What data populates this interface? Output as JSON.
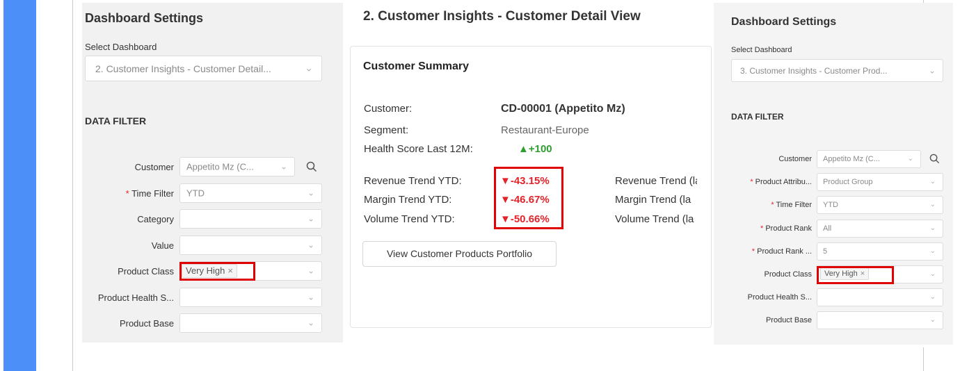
{
  "left_panel": {
    "title": "Dashboard Settings",
    "select_label": "Select Dashboard",
    "select_value": "2. Customer Insights - Customer Detail...",
    "section": "DATA FILTER",
    "filters": [
      {
        "label": "Customer",
        "value": "Appetito Mz (C...",
        "required": false
      },
      {
        "label": "Time Filter",
        "value": "YTD",
        "required": true
      },
      {
        "label": "Category",
        "value": "",
        "required": false
      },
      {
        "label": "Value",
        "value": "",
        "required": false
      },
      {
        "label": "Product Class",
        "value": "",
        "tag": "Very High",
        "required": false
      },
      {
        "label": "Product Health S...",
        "value": "",
        "required": false
      },
      {
        "label": "Product Base",
        "value": "",
        "required": false
      }
    ]
  },
  "middle": {
    "title": "2. Customer Insights - Customer Detail View",
    "card_title": "Customer Summary",
    "info": [
      {
        "label": "Customer:",
        "value": "CD-00001 (Appetito Mz)"
      },
      {
        "label": "Segment:",
        "value": "Restaurant-Europe"
      },
      {
        "label": "Health Score Last 12M:",
        "value": "▲+100"
      }
    ],
    "trends": [
      {
        "label": "Revenue Trend YTD:",
        "value": "▼-43.15%",
        "ghost": "Revenue Trend (la"
      },
      {
        "label": "Margin Trend YTD:",
        "value": "▼-46.67%",
        "ghost": "Margin Trend (la"
      },
      {
        "label": "Volume Trend YTD:",
        "value": "▼-50.66%",
        "ghost": "Volume Trend (la"
      }
    ],
    "button": "View Customer Products Portfolio"
  },
  "right_panel": {
    "title": "Dashboard Settings",
    "select_label": "Select Dashboard",
    "select_value": "3. Customer Insights - Customer Prod...",
    "section": "DATA FILTER",
    "filters": [
      {
        "label": "Customer",
        "value": "Appetito Mz (C...",
        "required": false
      },
      {
        "label": "Product Attribu...",
        "value": "Product Group",
        "required": true
      },
      {
        "label": "Time Filter",
        "value": "YTD",
        "required": true
      },
      {
        "label": "Product Rank",
        "value": "All",
        "required": true
      },
      {
        "label": "Product Rank ...",
        "value": "5",
        "required": true
      },
      {
        "label": "Product Class",
        "value": "",
        "tag": "Very High",
        "required": false
      },
      {
        "label": "Product Health S...",
        "value": "",
        "required": false
      },
      {
        "label": "Product Base",
        "value": "",
        "required": false
      }
    ]
  },
  "glyphs": {
    "chevron": "⌄",
    "tag_close": "×",
    "req": "*"
  },
  "colors": {
    "accent_blue": "#4d8ff8",
    "trend_red": "#e2232a",
    "health_green": "#2e9e2e",
    "highlight_red": "#e00000"
  }
}
